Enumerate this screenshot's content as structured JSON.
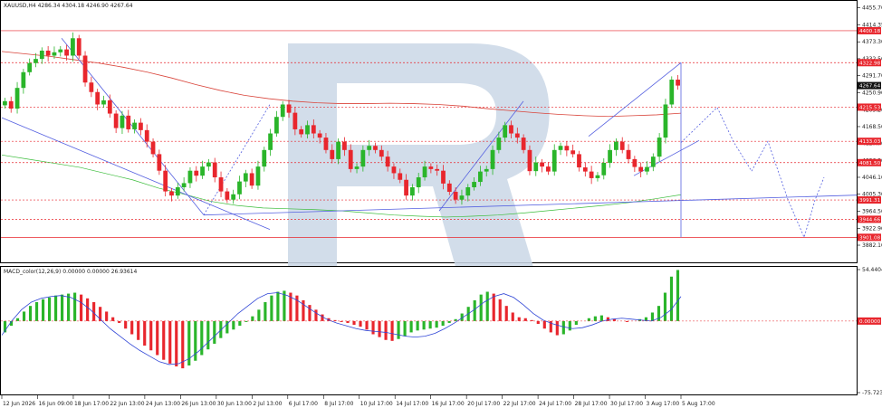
{
  "chart_data": [
    {
      "type": "candlestick",
      "title": "XAUUSD,H4  4286.34 4304.18 4246.90 4267.64",
      "ylim": [
        3845,
        4470
      ],
      "y_ticks": [
        "4455.70",
        "4414.35",
        "4373.30",
        "4332.50",
        "4291.70",
        "4250.90",
        "4209.20",
        "4168.50",
        "4127.70",
        "4086.90",
        "4046.10",
        "4005.30",
        "3964.50",
        "3922.90",
        "3882.10"
      ],
      "x_labels": [
        "12 Jun 2026",
        "16 Jun 09:00",
        "18 Jun 17:00",
        "22 Jun 13:00",
        "24 Jun 13:00",
        "26 Jun 13:00",
        "30 Jun 13:00",
        "2 Jul 13:00",
        "6 Jul 17:00",
        "8 Jul 17:00",
        "10 Jul 17:00",
        "14 Jul 17:00",
        "16 Jul 17:00",
        "20 Jul 17:00",
        "22 Jul 17:00",
        "24 Jul 17:00",
        "28 Jul 17:00",
        "30 Jul 17:00",
        "3 Aug 17:00",
        "5 Aug 17:00"
      ],
      "price_tags": [
        {
          "label": "4400.18",
          "value": 4400.18,
          "color": "#e8262d"
        },
        {
          "label": "4322.98",
          "value": 4322.98,
          "color": "#e8262d"
        },
        {
          "label": "4267.64",
          "value": 4267.64,
          "color": "#111111"
        },
        {
          "label": "4215.53",
          "value": 4215.53,
          "color": "#e8262d"
        },
        {
          "label": "4133.03",
          "value": 4133.03,
          "color": "#e8262d"
        },
        {
          "label": "4081.50",
          "value": 4081.5,
          "color": "#e8262d"
        },
        {
          "label": "3991.31",
          "value": 3991.31,
          "color": "#e8262d"
        },
        {
          "label": "3944.66",
          "value": 3944.66,
          "color": "#e8262d"
        },
        {
          "label": "3901.08",
          "value": 3901.08,
          "color": "#e8262d"
        }
      ],
      "series": [
        {
          "name": "close",
          "values": [
            4230,
            4212,
            4262,
            4300,
            4322,
            4332,
            4352,
            4340,
            4348,
            4355,
            4340,
            4382,
            4340,
            4275,
            4252,
            4222,
            4232,
            4200,
            4165,
            4195,
            4162,
            4178,
            4160,
            4132,
            4102,
            4062,
            4012,
            4002,
            4022,
            4032,
            4062,
            4050,
            4072,
            4082,
            4046,
            4012,
            3992,
            4005,
            4036,
            4056,
            4026,
            4072,
            4112,
            4152,
            4192,
            4222,
            4202,
            4162,
            4150,
            4172,
            4152,
            4142,
            4112,
            4090,
            4132,
            4112,
            4066,
            4072,
            4112,
            4122,
            4112,
            4096,
            4072,
            4056,
            4040,
            4002,
            4022,
            4046,
            4072,
            4066,
            4062,
            4031,
            4011,
            3992,
            4002,
            4022,
            4035,
            4060,
            4066,
            4112,
            4142,
            4172,
            4152,
            4142,
            4112,
            4061,
            4082,
            4072,
            4060,
            4112,
            4122,
            4111,
            4102,
            4070,
            4060,
            4044,
            4051,
            4081,
            4112,
            4132,
            4112,
            4090,
            4071,
            4060,
            4071,
            4096,
            4142,
            4222,
            4282,
            4267.64
          ]
        },
        {
          "name": "ma_red",
          "values": [
            4350,
            4344,
            4338,
            4330,
            4322,
            4312,
            4300,
            4286,
            4270,
            4256,
            4244,
            4236,
            4230,
            4226,
            4224,
            4224,
            4225,
            4224,
            4222,
            4218,
            4212,
            4207,
            4202,
            4198,
            4195,
            4193,
            4195,
            4197,
            4201
          ]
        },
        {
          "name": "ma_green",
          "values": [
            4100,
            4090,
            4080,
            4070,
            4055,
            4040,
            4020,
            4005,
            3988,
            3978,
            3972,
            3970,
            3968,
            3965,
            3960,
            3955,
            3952,
            3950,
            3952,
            3955,
            3960,
            3966,
            3972,
            3978,
            3985,
            3994,
            4004
          ]
        },
        {
          "name": "forecast",
          "values": [
            4130,
            4215,
            4132,
            4061,
            4133,
            3993,
            3901,
            3991,
            4046
          ]
        }
      ]
    },
    {
      "type": "bar",
      "title": "MACD_color(12,26,9) 0.00000 0.00000 26.93614",
      "ylim": [
        -75.7235,
        54.44
      ],
      "y_ticks": [
        "54.4404",
        "0.00000",
        "-75.72355"
      ],
      "series": [
        {
          "name": "histogram",
          "values": [
            -12,
            -5,
            3,
            10,
            16,
            20,
            23,
            25,
            27,
            28,
            29,
            30,
            28,
            24,
            20,
            15,
            10,
            4,
            -2,
            -8,
            -14,
            -20,
            -26,
            -31,
            -36,
            -41,
            -45,
            -48,
            -50,
            -47,
            -42,
            -36,
            -30,
            -24,
            -18,
            -13,
            -9,
            -5,
            -1,
            5,
            12,
            20,
            27,
            31,
            32,
            30,
            27,
            22,
            17,
            12,
            7,
            3,
            1,
            -1,
            -2,
            -4,
            -6,
            -9,
            -14,
            -17,
            -20,
            -21,
            -19,
            -16,
            -12,
            -10,
            -9,
            -8,
            -7,
            -5,
            -2,
            2,
            8,
            15,
            22,
            28,
            31,
            29,
            23,
            16,
            9,
            4,
            3,
            1,
            -3,
            -8,
            -12,
            -15,
            -14,
            -10,
            -4,
            0,
            3,
            5,
            6,
            4,
            2,
            0,
            -1,
            0,
            2,
            4,
            9,
            16,
            30,
            47,
            54
          ]
        },
        {
          "name": "signal",
          "values": [
            -15,
            0,
            12,
            20,
            24,
            26,
            27,
            25,
            20,
            12,
            2,
            -8,
            -16,
            -24,
            -31,
            -37,
            -43,
            -46,
            -45,
            -40,
            -32,
            -22,
            -12,
            -2,
            8,
            16,
            24,
            29,
            30,
            27,
            22,
            15,
            8,
            2,
            -2,
            -5,
            -8,
            -10,
            -11,
            -12,
            -14,
            -16,
            -17,
            -16,
            -13,
            -8,
            -2,
            5,
            12,
            20,
            26,
            29,
            25,
            17,
            8,
            1,
            -3,
            -6,
            -8,
            -7,
            -4,
            0,
            2,
            3,
            2,
            1,
            0,
            4,
            12,
            26
          ]
        }
      ]
    }
  ]
}
